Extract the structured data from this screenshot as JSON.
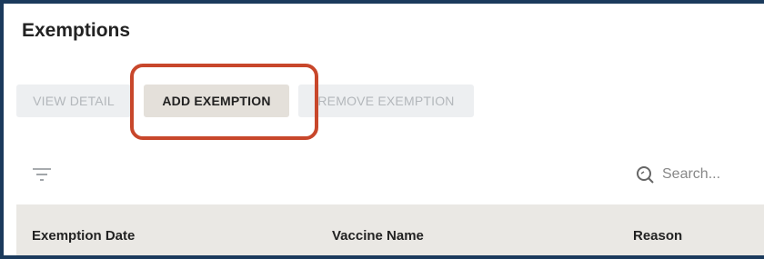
{
  "panel": {
    "title": "Exemptions"
  },
  "toolbar": {
    "view_detail": "VIEW DETAIL",
    "add_exemption": "ADD EXEMPTION",
    "remove_exemption": "REMOVE EXEMPTION"
  },
  "search": {
    "placeholder": "Search..."
  },
  "table": {
    "columns": [
      "Exemption Date",
      "Vaccine Name",
      "Reason"
    ]
  },
  "colors": {
    "frame_border": "#1b3a5c",
    "highlight": "#c8472b",
    "header_bg": "#eae8e4"
  },
  "icons": {
    "filter": "filter-icon",
    "search": "search-icon"
  }
}
